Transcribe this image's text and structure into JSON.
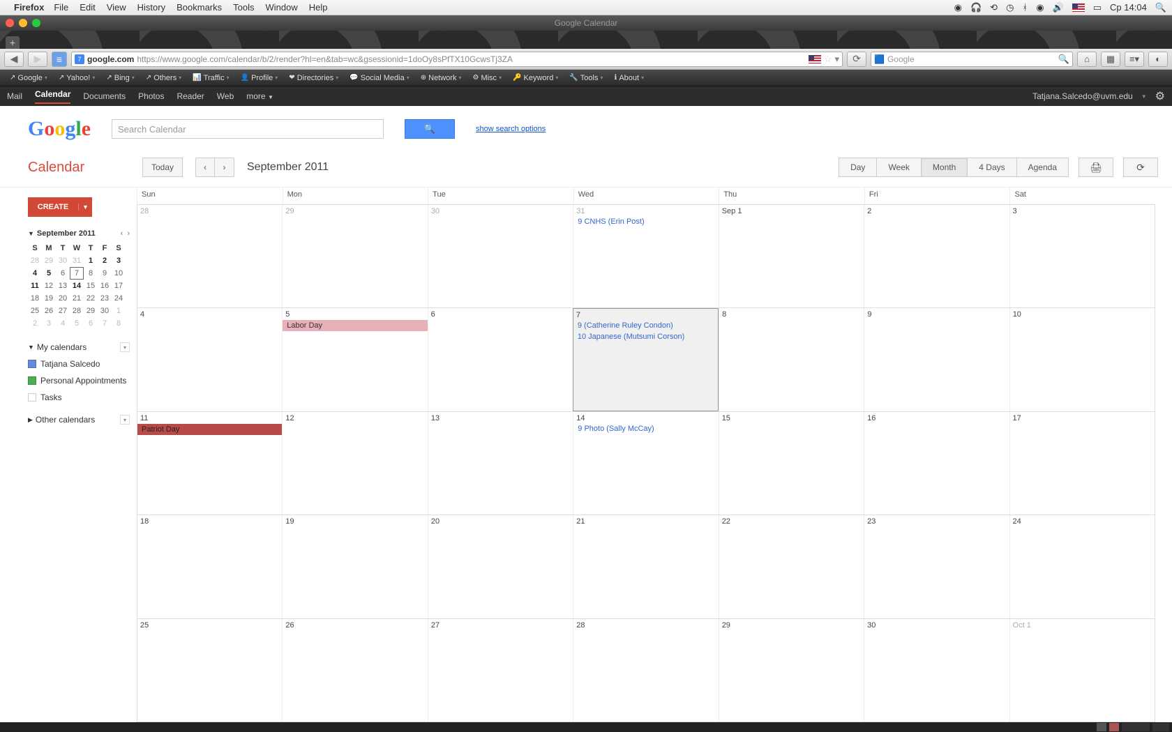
{
  "mac_menu": {
    "app": "Firefox",
    "items": [
      "File",
      "Edit",
      "View",
      "History",
      "Bookmarks",
      "Tools",
      "Window",
      "Help"
    ],
    "clock": "Ср 14:04"
  },
  "window": {
    "title": "Google Calendar"
  },
  "url": {
    "domain": "google.com",
    "path": "https://www.google.com/calendar/b/2/render?hl=en&tab=wc&gsessionid=1doOy8sPfTX10GcwsTj3ZA",
    "search_placeholder": "Google"
  },
  "bookmarks": [
    "Google",
    "Yahoo!",
    "Bing",
    "Others",
    "Traffic",
    "Profile",
    "Directories",
    "Social Media",
    "Network",
    "Misc",
    "Keyword",
    "Tools",
    "About"
  ],
  "google_nav": {
    "items": [
      "Mail",
      "Calendar",
      "Documents",
      "Photos",
      "Reader",
      "Web",
      "more"
    ],
    "active": "Calendar",
    "user": "Tatjana.Salcedo@uvm.edu"
  },
  "search": {
    "placeholder": "Search Calendar",
    "options": "show search options"
  },
  "calendar": {
    "title": "Calendar",
    "today_label": "Today",
    "month_label": "September 2011",
    "views": [
      "Day",
      "Week",
      "Month",
      "4 Days",
      "Agenda"
    ],
    "active_view": "Month"
  },
  "create": {
    "label": "CREATE"
  },
  "mini_cal": {
    "label": "September 2011",
    "dow": [
      "S",
      "M",
      "T",
      "W",
      "T",
      "F",
      "S"
    ],
    "rows": [
      [
        {
          "d": "28",
          "o": true
        },
        {
          "d": "29",
          "o": true
        },
        {
          "d": "30",
          "o": true
        },
        {
          "d": "31",
          "o": true
        },
        {
          "d": "1",
          "b": true
        },
        {
          "d": "2",
          "b": true
        },
        {
          "d": "3",
          "b": true
        }
      ],
      [
        {
          "d": "4",
          "b": true
        },
        {
          "d": "5",
          "b": true
        },
        {
          "d": "6"
        },
        {
          "d": "7",
          "t": true
        },
        {
          "d": "8"
        },
        {
          "d": "9"
        },
        {
          "d": "10"
        }
      ],
      [
        {
          "d": "11",
          "b": true
        },
        {
          "d": "12"
        },
        {
          "d": "13"
        },
        {
          "d": "14",
          "b": true
        },
        {
          "d": "15"
        },
        {
          "d": "16"
        },
        {
          "d": "17"
        }
      ],
      [
        {
          "d": "18"
        },
        {
          "d": "19"
        },
        {
          "d": "20"
        },
        {
          "d": "21"
        },
        {
          "d": "22"
        },
        {
          "d": "23"
        },
        {
          "d": "24"
        }
      ],
      [
        {
          "d": "25"
        },
        {
          "d": "26"
        },
        {
          "d": "27"
        },
        {
          "d": "28"
        },
        {
          "d": "29"
        },
        {
          "d": "30"
        },
        {
          "d": "1",
          "o": true
        }
      ],
      [
        {
          "d": "2",
          "o": true
        },
        {
          "d": "3",
          "o": true
        },
        {
          "d": "4",
          "o": true
        },
        {
          "d": "5",
          "o": true
        },
        {
          "d": "6",
          "o": true
        },
        {
          "d": "7",
          "o": true
        },
        {
          "d": "8",
          "o": true
        }
      ]
    ]
  },
  "my_calendars": {
    "label": "My calendars",
    "items": [
      {
        "name": "Tatjana Salcedo",
        "color": "#668cd9"
      },
      {
        "name": "Personal Appointments",
        "color": "#4cb052"
      },
      {
        "name": "Tasks",
        "color": "#ffffff"
      }
    ]
  },
  "other_calendars": {
    "label": "Other calendars"
  },
  "grid": {
    "dow": [
      "Sun",
      "Mon",
      "Tue",
      "Wed",
      "Thu",
      "Fri",
      "Sat"
    ],
    "weeks": [
      [
        {
          "num": "28",
          "other": true
        },
        {
          "num": "29",
          "other": true
        },
        {
          "num": "30",
          "other": true
        },
        {
          "num": "31",
          "other": true,
          "events": [
            {
              "time": "9",
              "text": "CNHS (Erin Post)"
            }
          ]
        },
        {
          "num": "Sep 1"
        },
        {
          "num": "2"
        },
        {
          "num": "3"
        }
      ],
      [
        {
          "num": "4"
        },
        {
          "num": "5",
          "events": [
            {
              "allday": true,
              "text": "Labor Day"
            }
          ]
        },
        {
          "num": "6"
        },
        {
          "num": "7",
          "today": true,
          "events": [
            {
              "time": "9",
              "text": "(Catherine Ruley Condon)"
            },
            {
              "time": "10",
              "text": "Japanese (Mutsumi Corson)"
            }
          ]
        },
        {
          "num": "8"
        },
        {
          "num": "9"
        },
        {
          "num": "10"
        }
      ],
      [
        {
          "num": "11",
          "events": [
            {
              "allday": true,
              "dark": true,
              "text": "Patriot Day"
            }
          ]
        },
        {
          "num": "12"
        },
        {
          "num": "13"
        },
        {
          "num": "14",
          "events": [
            {
              "time": "9",
              "text": "Photo (Sally McCay)"
            }
          ]
        },
        {
          "num": "15"
        },
        {
          "num": "16"
        },
        {
          "num": "17"
        }
      ],
      [
        {
          "num": "18"
        },
        {
          "num": "19"
        },
        {
          "num": "20"
        },
        {
          "num": "21"
        },
        {
          "num": "22"
        },
        {
          "num": "23"
        },
        {
          "num": "24"
        }
      ],
      [
        {
          "num": "25"
        },
        {
          "num": "26"
        },
        {
          "num": "27"
        },
        {
          "num": "28"
        },
        {
          "num": "29"
        },
        {
          "num": "30"
        },
        {
          "num": "Oct 1",
          "other": true
        }
      ]
    ]
  }
}
